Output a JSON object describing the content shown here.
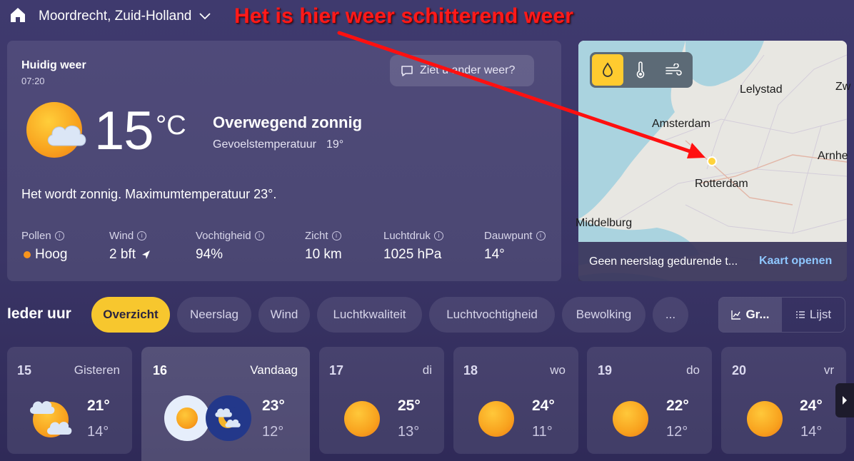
{
  "header": {
    "location": "Moordrecht, Zuid-Holland",
    "annotation": "Het is hier weer schitterend weer"
  },
  "current": {
    "title": "Huidig weer",
    "time": "07:20",
    "ask_button": "Ziet u ander weer?",
    "temperature": "15",
    "unit": "°C",
    "condition": "Overwegend zonnig",
    "feels_label": "Gevoelstemperatuur",
    "feels_value": "19°",
    "summary": "Het wordt zonnig. Maximumtemperatuur 23°.",
    "metrics": [
      {
        "label": "Pollen",
        "value": "Hoog"
      },
      {
        "label": "Wind",
        "value": "2 bft"
      },
      {
        "label": "Vochtigheid",
        "value": "94%"
      },
      {
        "label": "Zicht",
        "value": "10 km"
      },
      {
        "label": "Luchtdruk",
        "value": "1025 hPa"
      },
      {
        "label": "Dauwpunt",
        "value": "14°"
      }
    ]
  },
  "map": {
    "cities": {
      "lelystad": "Lelystad",
      "zw": "Zw",
      "amsterdam": "Amsterdam",
      "arnhem": "Arnhe",
      "rotterdam": "Rotterdam",
      "middelburg": "Middelburg"
    },
    "footer_text": "Geen neerslag gedurende t...",
    "open_link": "Kaart openen"
  },
  "hourly": {
    "title": "Ieder uur",
    "chips": [
      "Overzicht",
      "Neerslag",
      "Wind",
      "Luchtkwaliteit",
      "Luchtvochtigheid",
      "Bewolking",
      "..."
    ],
    "view_graph": "Gr...",
    "view_list": "Lijst"
  },
  "days": [
    {
      "num": "15",
      "name": "Gisteren",
      "max": "21°",
      "min": "14°"
    },
    {
      "num": "16",
      "name": "Vandaag",
      "max": "23°",
      "min": "12°"
    },
    {
      "num": "17",
      "name": "di",
      "max": "25°",
      "min": "13°"
    },
    {
      "num": "18",
      "name": "wo",
      "max": "24°",
      "min": "11°"
    },
    {
      "num": "19",
      "name": "do",
      "max": "22°",
      "min": "12°"
    },
    {
      "num": "20",
      "name": "vr",
      "max": "24°",
      "min": "14°"
    }
  ]
}
